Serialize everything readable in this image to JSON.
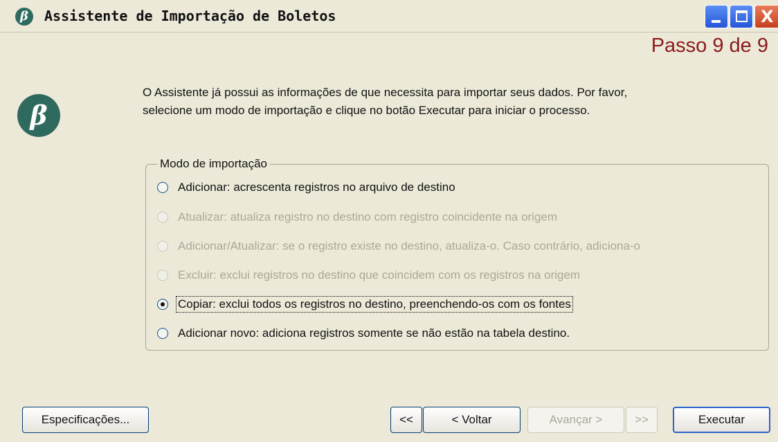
{
  "window": {
    "title": "Assistente de Importação de Boletos",
    "app_icon": "beta-logo",
    "controls": {
      "minimize": "minimize-icon",
      "maximize": "maximize-icon",
      "close_glyph": "X"
    }
  },
  "wizard": {
    "step_label": "Passo 9 de 9",
    "description_lines": [
      "O Assistente já possui as informações de que necessita para importar seus dados. Por favor,",
      "selecione um modo de importação e clique no botão Executar para iniciar o processo."
    ]
  },
  "import_mode": {
    "legend": "Modo de importação",
    "options": [
      {
        "label": "Adicionar: acrescenta registros no arquivo de destino",
        "enabled": true,
        "checked": false
      },
      {
        "label": "Atualizar: atualiza registro no destino com registro coincidente na origem",
        "enabled": false,
        "checked": false
      },
      {
        "label": "Adicionar/Atualizar: se o registro existe no destino, atualiza-o. Caso contrário, adiciona-o",
        "enabled": false,
        "checked": false
      },
      {
        "label": "Excluir: exclui registros no destino que coincidem com os registros na origem",
        "enabled": false,
        "checked": false
      },
      {
        "label": "Copiar: exclui todos os registros no destino, preenchendo-os com os fontes",
        "enabled": true,
        "checked": true
      },
      {
        "label": "Adicionar novo: adiciona registros somente se não estão na tabela destino.",
        "enabled": true,
        "checked": false
      }
    ]
  },
  "buttons": {
    "specifications": "Especificações...",
    "first": "<<",
    "back": "< Voltar",
    "next": "Avançar >",
    "last": ">>",
    "execute": "Executar"
  },
  "colors": {
    "step_label": "#8b1a1a",
    "logo": "#2e6b5e",
    "disabled_text": "#aca899"
  }
}
